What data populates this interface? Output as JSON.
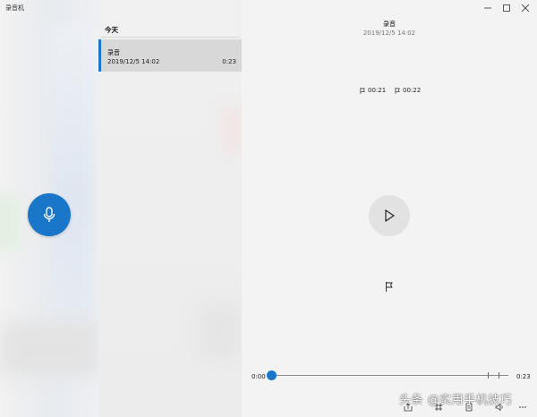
{
  "window": {
    "app_title": "录音机"
  },
  "sidebar": {
    "record_icon": "microphone-icon",
    "accent_color": "#1976c9"
  },
  "list": {
    "group_header": "今天",
    "items": [
      {
        "title": "录音",
        "date": "2019/12/5 14:02",
        "duration": "0:23"
      }
    ]
  },
  "detail": {
    "title": "录音",
    "date": "2019/12/5 14:02",
    "markers": [
      "00:21",
      "00:22"
    ],
    "play_icon": "play-icon",
    "add_marker_icon": "flag-icon"
  },
  "playback": {
    "current_time": "0:00",
    "total_time": "0:23",
    "progress": 0,
    "marker_fractions": [
      0.913,
      0.957
    ]
  },
  "toolbar": {
    "icons": [
      "share-icon",
      "trim-icon",
      "rename-icon",
      "speed-icon",
      "more-icon"
    ]
  },
  "watermark": {
    "text": "头条 @实用手机技巧"
  }
}
